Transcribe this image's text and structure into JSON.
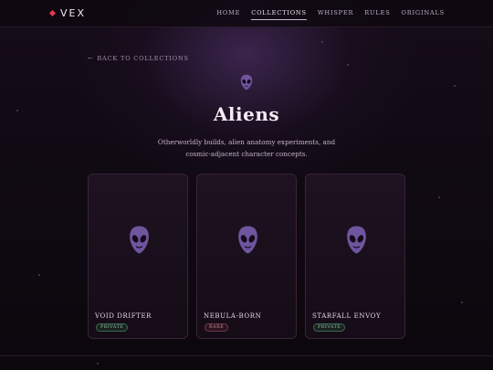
{
  "nav": {
    "logo": "VEX",
    "items": [
      {
        "label": "Home",
        "active": false
      },
      {
        "label": "Collections",
        "active": true
      },
      {
        "label": "Whisper",
        "active": false
      },
      {
        "label": "Rules",
        "active": false
      },
      {
        "label": "Originals",
        "active": false
      }
    ]
  },
  "page": {
    "back_label": "Back to Collections",
    "back_arrow": "←",
    "header_icon": "alien-icon",
    "title": "Aliens",
    "description": "Otherworldly builds, alien anatomy experiments, and cosmic-adjacent character concepts."
  },
  "cards": [
    {
      "name": "Void Drifter",
      "badge": "Private",
      "badge_color": "#8bc3a1",
      "icon": "alien-icon"
    },
    {
      "name": "Nebula-Born",
      "badge": "Rare",
      "badge_color": "#d08c9d",
      "icon": "alien-icon"
    },
    {
      "name": "Starfall Envoy",
      "badge": "Private",
      "badge_color": "#8bc3a1",
      "icon": "alien-icon"
    }
  ],
  "colors": {
    "accent": "#e3384f",
    "alien": "#6f559e",
    "background": "#0c070d"
  }
}
